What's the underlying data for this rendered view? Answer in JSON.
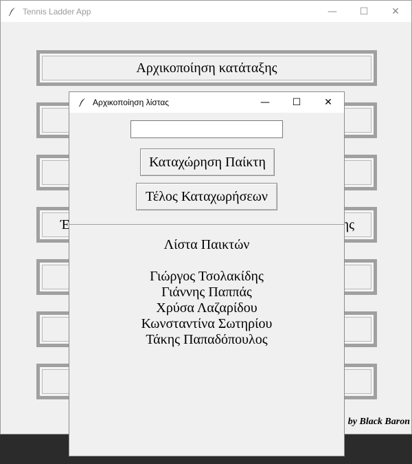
{
  "main_window": {
    "title": "Tennis Ladder App",
    "controls": {
      "minimize": "—",
      "maximize": "☐",
      "close": "✕"
    },
    "menu_buttons": [
      {
        "label": "Αρχικοποίηση κατάταξης"
      },
      {
        "label": ""
      },
      {
        "label": ""
      },
      {
        "label": "",
        "visible_left": "Έλ",
        "visible_right": "ης"
      },
      {
        "label": ""
      },
      {
        "label": ""
      },
      {
        "label": ""
      }
    ],
    "credit": "by Black Baron"
  },
  "dialog": {
    "title": "Αρχικοποίηση λίστας",
    "controls": {
      "minimize": "—",
      "maximize": "☐",
      "close": "✕"
    },
    "name_input": {
      "value": "",
      "placeholder": ""
    },
    "register_button": "Καταχώρηση Παίκτη",
    "finish_button": "Τέλος Καταχωρήσεων",
    "list_title": "Λίστα Παικτών",
    "players": [
      "Γιώργος Τσολακίδης",
      "Γιάννης Παππάς",
      "Χρύσα Λαζαρίδου",
      "Κωνσταντίνα Σωτηρίου",
      "Τάκης Παπαδόπουλος"
    ]
  }
}
